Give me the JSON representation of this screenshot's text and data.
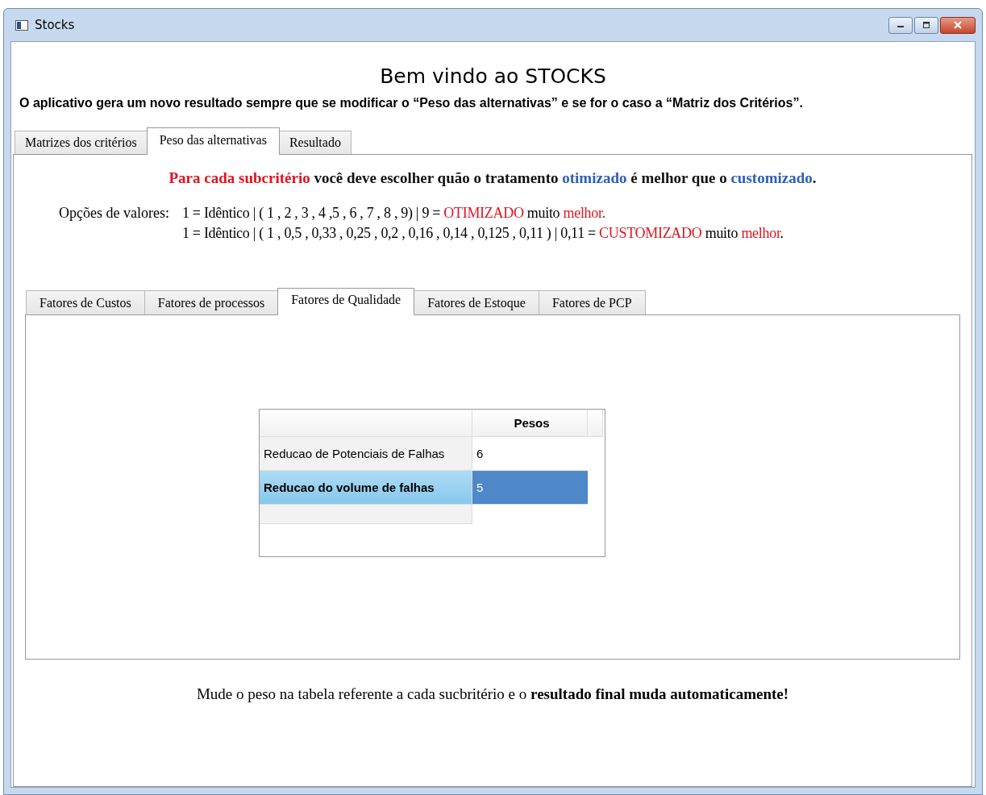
{
  "window": {
    "title": "Stocks"
  },
  "heading": "Bem vindo ao STOCKS",
  "intro": "O aplicativo gera um novo resultado sempre que se modificar o “Peso das alternativas” e se for o caso a “Matriz dos Critérios”.",
  "tabs": [
    {
      "label": "Matrizes dos critérios",
      "selected": false
    },
    {
      "label": "Peso das alternativas",
      "selected": true
    },
    {
      "label": "Resultado",
      "selected": false
    }
  ],
  "instruction": {
    "segments": [
      {
        "text": "Para cada subcritério",
        "kind": "warning"
      },
      {
        "text": " você deve escolher quão o tratamento ",
        "kind": "plain"
      },
      {
        "text": "otimizado",
        "kind": "accent"
      },
      {
        "text": " é melhor que o ",
        "kind": "plain"
      },
      {
        "text": "customizado",
        "kind": "accent"
      },
      {
        "text": ".",
        "kind": "plain"
      }
    ]
  },
  "options": {
    "label": "Opções de valores:",
    "lines": [
      {
        "segments": [
          {
            "text": "1 = Idêntico | ( 1 , 2 , 3 , 4 ,5 , 6 , 7 , 8 , 9) | 9 = ",
            "kind": "plain"
          },
          {
            "text": "OTIMIZADO",
            "kind": "warning"
          },
          {
            "text": " muito ",
            "kind": "plain"
          },
          {
            "text": "melhor.",
            "kind": "warning"
          }
        ]
      },
      {
        "segments": [
          {
            "text": "1 = Idêntico | ( 1 , 0,5 , 0,33 , 0,25 , 0,2 , 0,16 , 0,14 , 0,125 , 0,11 ) | 0,11 = ",
            "kind": "plain"
          },
          {
            "text": "CUSTOMIZADO",
            "kind": "warning"
          },
          {
            "text": " muito ",
            "kind": "plain"
          },
          {
            "text": "melhor",
            "kind": "warning"
          },
          {
            "text": ".",
            "kind": "plain"
          }
        ]
      }
    ]
  },
  "subtabs": [
    {
      "label": "Fatores de Custos",
      "selected": false
    },
    {
      "label": "Fatores de processos",
      "selected": false
    },
    {
      "label": "Fatores de Qualidade",
      "selected": true
    },
    {
      "label": "Fatores de Estoque",
      "selected": false
    },
    {
      "label": "Fatores de PCP",
      "selected": false
    }
  ],
  "table": {
    "columns": [
      "Pesos"
    ],
    "rows": [
      {
        "name": "Reducao de Potenciais de Falhas",
        "value": "6",
        "selected": false
      },
      {
        "name": "Reducao do volume de falhas",
        "value": "5",
        "selected": true
      }
    ]
  },
  "footer": "Mude o peso na tabela referente a cada sucbritério e o **resultado final muda automaticamente!**"
}
